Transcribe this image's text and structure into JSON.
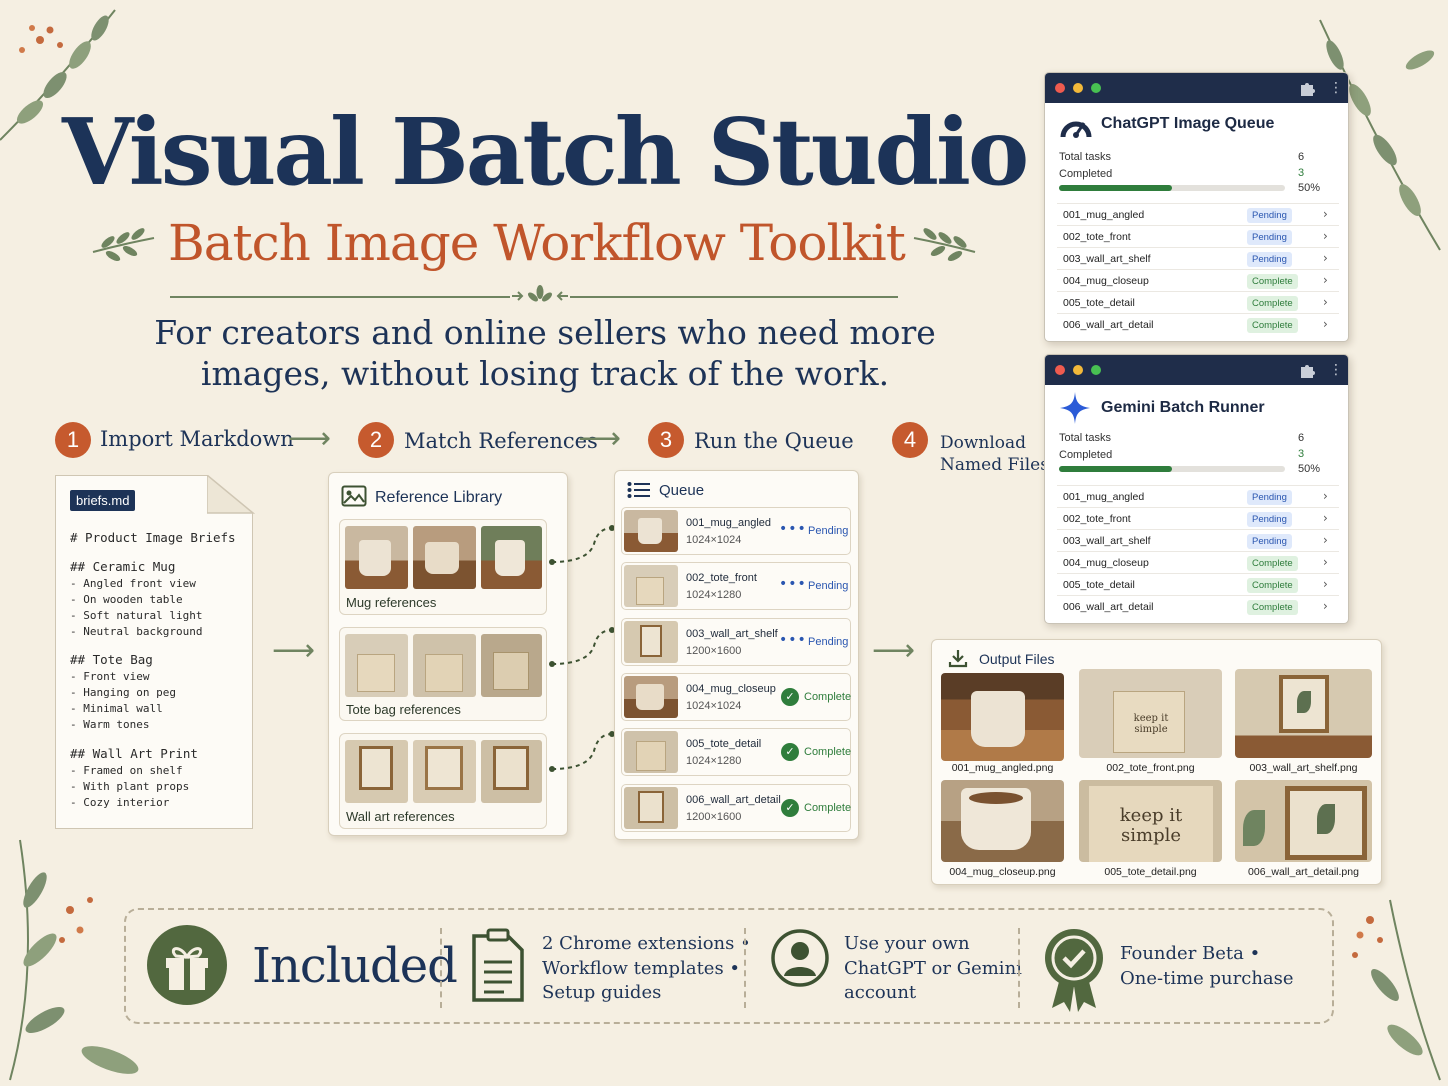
{
  "header": {
    "title": "Visual Batch Studio",
    "subtitle": "Batch Image Workflow Toolkit",
    "tagline_line1": "For creators and online sellers who need more",
    "tagline_line2": "images, without losing track of the work."
  },
  "steps": [
    {
      "num": "1",
      "label": "Import Markdown"
    },
    {
      "num": "2",
      "label": "Match References"
    },
    {
      "num": "3",
      "label": "Run the Queue"
    },
    {
      "num": "4",
      "label_line1": "Download",
      "label_line2": "Named Files"
    }
  ],
  "markdown_doc": {
    "filename": "briefs.md",
    "heading": "# Product Image Briefs",
    "sections": [
      {
        "heading": "## Ceramic Mug",
        "items": [
          "- Angled front view",
          "- On wooden table",
          "- Soft natural light",
          "- Neutral background"
        ]
      },
      {
        "heading": "## Tote Bag",
        "items": [
          "- Front view",
          "- Hanging on peg",
          "- Minimal wall",
          "- Warm tones"
        ]
      },
      {
        "heading": "## Wall Art Print",
        "items": [
          "- Framed on shelf",
          "- With plant props",
          "- Cozy interior"
        ]
      }
    ]
  },
  "reference_library": {
    "title": "Reference Library",
    "groups": [
      {
        "label": "Mug references"
      },
      {
        "label": "Tote bag references"
      },
      {
        "label": "Wall art references"
      }
    ]
  },
  "queue": {
    "title": "Queue",
    "items": [
      {
        "name": "001_mug_angled",
        "size": "1024×1024",
        "status": "Pending"
      },
      {
        "name": "002_tote_front",
        "size": "1024×1280",
        "status": "Pending"
      },
      {
        "name": "003_wall_art_shelf",
        "size": "1200×1600",
        "status": "Pending"
      },
      {
        "name": "004_mug_closeup",
        "size": "1024×1024",
        "status": "Complete"
      },
      {
        "name": "005_tote_detail",
        "size": "1024×1280",
        "status": "Complete"
      },
      {
        "name": "006_wall_art_detail",
        "size": "1200×1600",
        "status": "Complete"
      }
    ]
  },
  "extensions": [
    {
      "title": "ChatGPT Image Queue",
      "total_label": "Total tasks",
      "total": "6",
      "completed_label": "Completed",
      "completed": "3",
      "progress": "50%",
      "rows": [
        {
          "name": "001_mug_angled",
          "status": "Pending"
        },
        {
          "name": "002_tote_front",
          "status": "Pending"
        },
        {
          "name": "003_wall_art_shelf",
          "status": "Pending"
        },
        {
          "name": "004_mug_closeup",
          "status": "Complete"
        },
        {
          "name": "005_tote_detail",
          "status": "Complete"
        },
        {
          "name": "006_wall_art_detail",
          "status": "Complete"
        }
      ]
    },
    {
      "title": "Gemini Batch Runner",
      "total_label": "Total tasks",
      "total": "6",
      "completed_label": "Completed",
      "completed": "3",
      "progress": "50%",
      "rows": [
        {
          "name": "001_mug_angled",
          "status": "Pending"
        },
        {
          "name": "002_tote_front",
          "status": "Pending"
        },
        {
          "name": "003_wall_art_shelf",
          "status": "Pending"
        },
        {
          "name": "004_mug_closeup",
          "status": "Complete"
        },
        {
          "name": "005_tote_detail",
          "status": "Complete"
        },
        {
          "name": "006_wall_art_detail",
          "status": "Complete"
        }
      ]
    }
  ],
  "output_files": {
    "title": "Output Files",
    "files": [
      {
        "name": "001_mug_angled.png",
        "overlay": ""
      },
      {
        "name": "002_tote_front.png",
        "overlay": "keep it\nsimple"
      },
      {
        "name": "003_wall_art_shelf.png",
        "overlay": ""
      },
      {
        "name": "004_mug_closeup.png",
        "overlay": ""
      },
      {
        "name": "005_tote_detail.png",
        "overlay": "keep it\nsimple"
      },
      {
        "name": "006_wall_art_detail.png",
        "overlay": ""
      }
    ]
  },
  "included": {
    "title": "Included",
    "list": [
      "2 Chrome extensions •",
      "Workflow templates •",
      "Setup guides"
    ],
    "account": [
      "Use your own",
      "ChatGPT or Gemini",
      "account"
    ],
    "offer": [
      "Founder Beta •",
      "One-time purchase"
    ]
  },
  "colors": {
    "navy": "#1c3358",
    "terracotta": "#c65a2e",
    "sage": "#6f8460",
    "cream": "#f5efe2",
    "pending_blue": "#2a56b0",
    "complete_green": "#2f7d3c"
  }
}
